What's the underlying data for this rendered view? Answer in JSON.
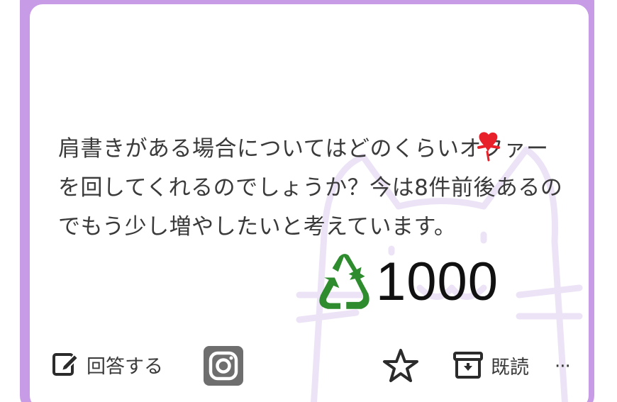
{
  "question": {
    "lines": [
      "肩書きがある場合についてはどのくらいオファー",
      "を回してくれるのでしょうか？今は8件前後あるの",
      "でもう少し増やしたいと考えています。"
    ]
  },
  "stamp": {
    "icon": "recycle-icon",
    "count": "1000"
  },
  "toolbar": {
    "reply_label": "回答する",
    "read_label": "既読",
    "more_label": "···"
  },
  "colors": {
    "frame": "#c79be6",
    "recycle": "#2e8b2e",
    "heart": "#e8202a"
  }
}
